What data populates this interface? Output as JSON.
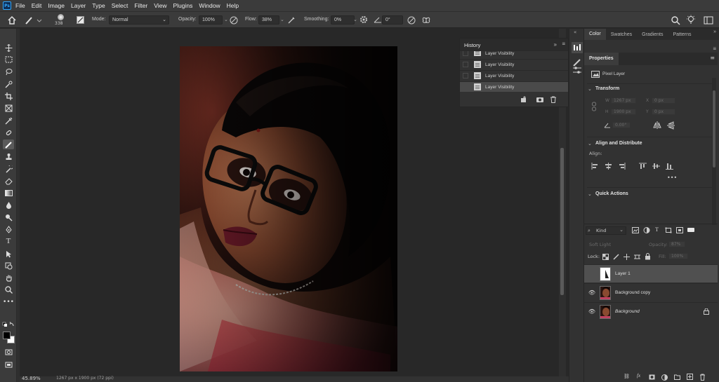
{
  "menubar": {
    "logo": "Ps",
    "items": [
      "File",
      "Edit",
      "Image",
      "Layer",
      "Type",
      "Select",
      "Filter",
      "View",
      "Plugins",
      "Window",
      "Help"
    ]
  },
  "options": {
    "brush_size": "338",
    "mode_label": "Mode:",
    "mode_value": "Normal",
    "opacity_label": "Opacity:",
    "opacity_value": "100%",
    "flow_label": "Flow:",
    "flow_value": "38%",
    "smoothing_label": "Smoothing:",
    "smoothing_value": "0%",
    "angle_value": "0°"
  },
  "status": {
    "zoom": "45.89%",
    "doc_info": "1267 px x 1900 px (72 ppi)"
  },
  "history": {
    "title": "History",
    "items": [
      {
        "label": "Layer Visibility",
        "selected": false
      },
      {
        "label": "Layer Visibility",
        "selected": false
      },
      {
        "label": "Layer Visibility",
        "selected": false
      },
      {
        "label": "Layer Visibility",
        "selected": true
      }
    ]
  },
  "right_tabs": [
    "Color",
    "Swatches",
    "Gradients",
    "Patterns"
  ],
  "properties": {
    "title": "Properties",
    "layer_type": "Pixel Layer",
    "transform_title": "Transform",
    "w_label": "W",
    "w_value": "1267 px",
    "h_label": "H",
    "h_value": "1900 px",
    "x_label": "X",
    "x_value": "0 px",
    "y_label": "Y",
    "y_value": "0 px",
    "angle_value": "0.00°",
    "align_title": "Align and Distribute",
    "align_label": "Align:",
    "quick_title": "Quick Actions"
  },
  "layers_panel": {
    "filter_kind": "Kind",
    "blend_mode": "Soft Light",
    "opacity_label": "Opacity:",
    "opacity_value": "87%",
    "lock_label": "Lock:",
    "fill_label": "Fill:",
    "fill_value": "100%",
    "layers": [
      {
        "name": "Layer 1",
        "visible": false,
        "selected": true
      },
      {
        "name": "Background copy",
        "visible": true,
        "selected": false
      },
      {
        "name": "Background",
        "visible": true,
        "selected": false,
        "locked": true
      }
    ]
  },
  "colors": {
    "accent": "#31a8ff",
    "chrome": "#3b3b3b",
    "panel": "#323232",
    "canvas": "#282828"
  }
}
